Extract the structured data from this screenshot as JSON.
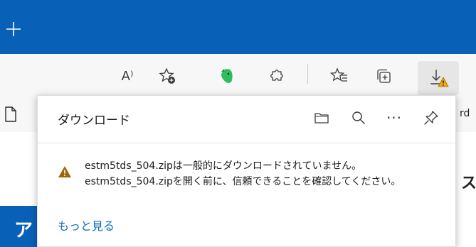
{
  "toolbar": {
    "read_aloud_label": "A⁾"
  },
  "favorites": {
    "tail_text": "rd"
  },
  "page": {
    "block_text": "ア",
    "right_glyph": "ス"
  },
  "downloads": {
    "title": "ダウンロード",
    "more_glyph": "···",
    "warning_line1": "estm5tds_504.zipは一般的にダウンロードされていません。",
    "warning_line2": "estm5tds_504.zipを開く前に、信頼できることを確認してください。",
    "more_link": "もっと見る"
  },
  "colors": {
    "titlebar": "#0960b7",
    "warning": "#a0650a",
    "link": "#0f6cbd",
    "evernote": "#2dbe60"
  },
  "icons": [
    "new-tab-icon",
    "read-aloud-icon",
    "add-favorite-icon",
    "evernote-icon",
    "extensions-icon",
    "favorites-icon",
    "collections-icon",
    "downloads-icon",
    "page-icon",
    "folder-icon",
    "search-icon",
    "more-icon",
    "pin-icon",
    "warning-icon"
  ]
}
